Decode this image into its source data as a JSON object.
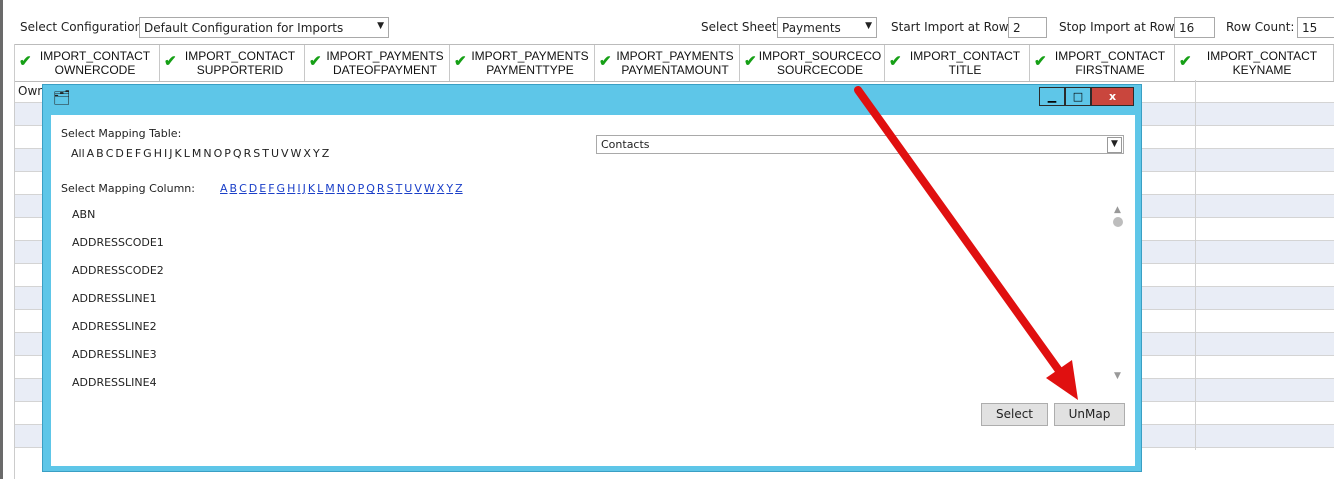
{
  "toolbar": {
    "select_config_label": "Select Configuration",
    "config_value": "Default Configuration for Imports",
    "select_sheet_label": "Select Sheet",
    "sheet_value": "Payments",
    "start_row_label": "Start Import at Row:",
    "start_row_value": "2",
    "stop_row_label": "Stop Import at Row:",
    "stop_row_value": "16",
    "row_count_label": "Row Count:",
    "row_count_value": "15"
  },
  "columns": [
    {
      "line1": "IMPORT_CONTACT",
      "line2": "OWNERCODE"
    },
    {
      "line1": "IMPORT_CONTACT",
      "line2": "SUPPORTERID"
    },
    {
      "line1": "IMPORT_PAYMENTS",
      "line2": "DATEOFPAYMENT"
    },
    {
      "line1": "IMPORT_PAYMENTS",
      "line2": "PAYMENTTYPE"
    },
    {
      "line1": "IMPORT_PAYMENTS",
      "line2": "PAYMENTAMOUNT"
    },
    {
      "line1": "IMPORT_SOURCECO",
      "line2": "SOURCECODE"
    },
    {
      "line1": "IMPORT_CONTACT",
      "line2": "TITLE"
    },
    {
      "line1": "IMPORT_CONTACT",
      "line2": "FIRSTNAME"
    },
    {
      "line1": "IMPORT_CONTACT",
      "line2": "KEYNAME"
    }
  ],
  "grid": {
    "first_cell": "Own"
  },
  "dialog": {
    "mapping_table_label": "Select Mapping Table:",
    "table_letters": [
      "All",
      "A",
      "B",
      "C",
      "D",
      "E",
      "F",
      "G",
      "H",
      "I",
      "J",
      "K",
      "L",
      "M",
      "N",
      "O",
      "P",
      "Q",
      "R",
      "S",
      "T",
      "U",
      "V",
      "W",
      "X",
      "Y",
      "Z"
    ],
    "table_value": "Contacts",
    "mapping_column_label": "Select Mapping Column:",
    "column_letters": [
      "A",
      "B",
      "C",
      "D",
      "E",
      "F",
      "G",
      "H",
      "I",
      "J",
      "K",
      "L",
      "M",
      "N",
      "O",
      "P",
      "Q",
      "R",
      "S",
      "T",
      "U",
      "V",
      "W",
      "X",
      "Y",
      "Z"
    ],
    "column_items": [
      "ABN",
      "ADDRESSCODE1",
      "ADDRESSCODE2",
      "ADDRESSLINE1",
      "ADDRESSLINE2",
      "ADDRESSLINE3",
      "ADDRESSLINE4"
    ],
    "select_button": "Select",
    "unmap_button": "UnMap",
    "minimize_glyph": "▁",
    "maximize_glyph": "□",
    "close_glyph": "x"
  },
  "colors": {
    "arrow": "#e01010",
    "dialog_frame": "#5ec6e8",
    "close_button": "#c9463d"
  }
}
